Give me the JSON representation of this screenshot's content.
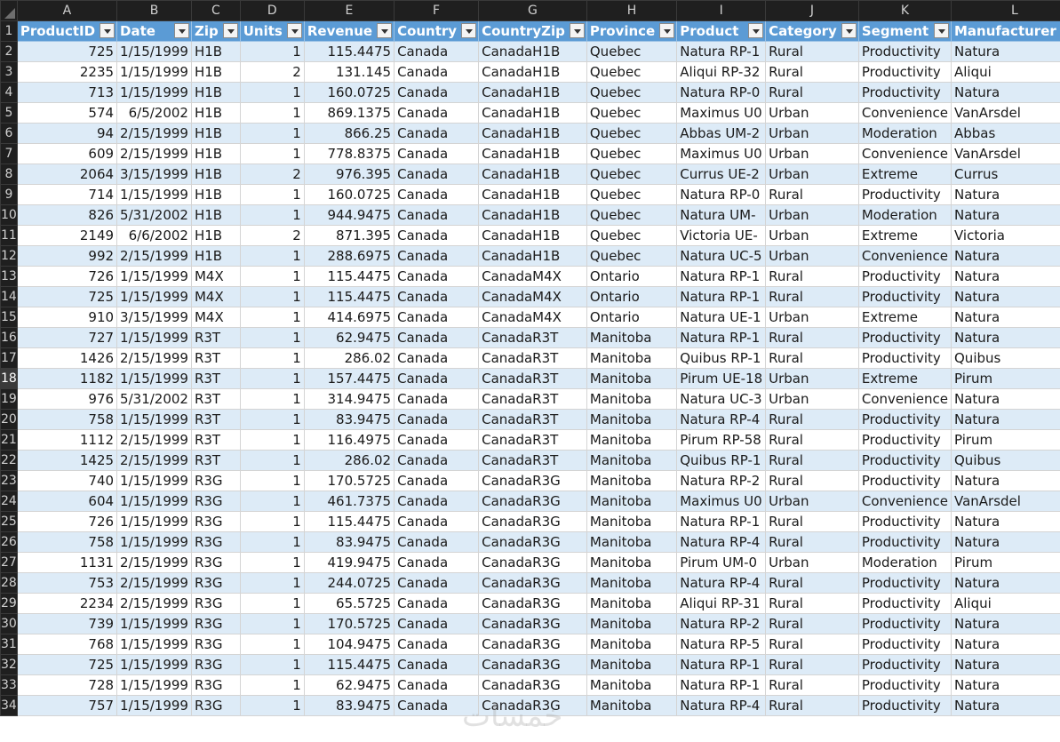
{
  "sheet": {
    "column_letters": [
      "A",
      "B",
      "C",
      "D",
      "E",
      "F",
      "G",
      "H",
      "I",
      "J",
      "K",
      "L"
    ],
    "headers": [
      "ProductID",
      "Date",
      "Zip",
      "Units",
      "Revenue",
      "Country",
      "CountryZip",
      "Province",
      "Product",
      "Category",
      "Segment",
      "Manufacturer"
    ],
    "selected_row": "18",
    "rows": [
      {
        "n": "2",
        "cells": [
          "725",
          "1/15/1999",
          "H1B",
          "1",
          "115.4475",
          "Canada",
          "CanadaH1B",
          "Quebec",
          "Natura RP-1",
          "Rural",
          "Productivity",
          "Natura"
        ]
      },
      {
        "n": "3",
        "cells": [
          "2235",
          "1/15/1999",
          "H1B",
          "2",
          "131.145",
          "Canada",
          "CanadaH1B",
          "Quebec",
          "Aliqui RP-32",
          "Rural",
          "Productivity",
          "Aliqui"
        ]
      },
      {
        "n": "4",
        "cells": [
          "713",
          "1/15/1999",
          "H1B",
          "1",
          "160.0725",
          "Canada",
          "CanadaH1B",
          "Quebec",
          "Natura RP-0",
          "Rural",
          "Productivity",
          "Natura"
        ]
      },
      {
        "n": "5",
        "cells": [
          "574",
          "6/5/2002",
          "H1B",
          "1",
          "869.1375",
          "Canada",
          "CanadaH1B",
          "Quebec",
          "Maximus U0",
          "Urban",
          "Convenience",
          "VanArsdel"
        ]
      },
      {
        "n": "6",
        "cells": [
          "94",
          "2/15/1999",
          "H1B",
          "1",
          "866.25",
          "Canada",
          "CanadaH1B",
          "Quebec",
          "Abbas UM-2",
          "Urban",
          "Moderation",
          "Abbas"
        ]
      },
      {
        "n": "7",
        "cells": [
          "609",
          "2/15/1999",
          "H1B",
          "1",
          "778.8375",
          "Canada",
          "CanadaH1B",
          "Quebec",
          "Maximus U0",
          "Urban",
          "Convenience",
          "VanArsdel"
        ]
      },
      {
        "n": "8",
        "cells": [
          "2064",
          "3/15/1999",
          "H1B",
          "2",
          "976.395",
          "Canada",
          "CanadaH1B",
          "Quebec",
          "Currus UE-2",
          "Urban",
          "Extreme",
          "Currus"
        ]
      },
      {
        "n": "9",
        "cells": [
          "714",
          "1/15/1999",
          "H1B",
          "1",
          "160.0725",
          "Canada",
          "CanadaH1B",
          "Quebec",
          "Natura RP-0",
          "Rural",
          "Productivity",
          "Natura"
        ]
      },
      {
        "n": "10",
        "cells": [
          "826",
          "5/31/2002",
          "H1B",
          "1",
          "944.9475",
          "Canada",
          "CanadaH1B",
          "Quebec",
          "Natura UM-",
          "Urban",
          "Moderation",
          "Natura"
        ]
      },
      {
        "n": "11",
        "cells": [
          "2149",
          "6/6/2002",
          "H1B",
          "2",
          "871.395",
          "Canada",
          "CanadaH1B",
          "Quebec",
          "Victoria UE-",
          "Urban",
          "Extreme",
          "Victoria"
        ]
      },
      {
        "n": "12",
        "cells": [
          "992",
          "2/15/1999",
          "H1B",
          "1",
          "288.6975",
          "Canada",
          "CanadaH1B",
          "Quebec",
          "Natura UC-5",
          "Urban",
          "Convenience",
          "Natura"
        ]
      },
      {
        "n": "13",
        "cells": [
          "726",
          "1/15/1999",
          "M4X",
          "1",
          "115.4475",
          "Canada",
          "CanadaM4X",
          "Ontario",
          "Natura RP-1",
          "Rural",
          "Productivity",
          "Natura"
        ]
      },
      {
        "n": "14",
        "cells": [
          "725",
          "1/15/1999",
          "M4X",
          "1",
          "115.4475",
          "Canada",
          "CanadaM4X",
          "Ontario",
          "Natura RP-1",
          "Rural",
          "Productivity",
          "Natura"
        ]
      },
      {
        "n": "15",
        "cells": [
          "910",
          "3/15/1999",
          "M4X",
          "1",
          "414.6975",
          "Canada",
          "CanadaM4X",
          "Ontario",
          "Natura UE-1",
          "Urban",
          "Extreme",
          "Natura"
        ]
      },
      {
        "n": "16",
        "cells": [
          "727",
          "1/15/1999",
          "R3T",
          "1",
          "62.9475",
          "Canada",
          "CanadaR3T",
          "Manitoba",
          "Natura RP-1",
          "Rural",
          "Productivity",
          "Natura"
        ]
      },
      {
        "n": "17",
        "cells": [
          "1426",
          "2/15/1999",
          "R3T",
          "1",
          "286.02",
          "Canada",
          "CanadaR3T",
          "Manitoba",
          "Quibus RP-1",
          "Rural",
          "Productivity",
          "Quibus"
        ]
      },
      {
        "n": "18",
        "cells": [
          "1182",
          "1/15/1999",
          "R3T",
          "1",
          "157.4475",
          "Canada",
          "CanadaR3T",
          "Manitoba",
          "Pirum UE-18",
          "Urban",
          "Extreme",
          "Pirum"
        ]
      },
      {
        "n": "19",
        "cells": [
          "976",
          "5/31/2002",
          "R3T",
          "1",
          "314.9475",
          "Canada",
          "CanadaR3T",
          "Manitoba",
          "Natura UC-3",
          "Urban",
          "Convenience",
          "Natura"
        ]
      },
      {
        "n": "20",
        "cells": [
          "758",
          "1/15/1999",
          "R3T",
          "1",
          "83.9475",
          "Canada",
          "CanadaR3T",
          "Manitoba",
          "Natura RP-4",
          "Rural",
          "Productivity",
          "Natura"
        ]
      },
      {
        "n": "21",
        "cells": [
          "1112",
          "2/15/1999",
          "R3T",
          "1",
          "116.4975",
          "Canada",
          "CanadaR3T",
          "Manitoba",
          "Pirum RP-58",
          "Rural",
          "Productivity",
          "Pirum"
        ]
      },
      {
        "n": "22",
        "cells": [
          "1425",
          "2/15/1999",
          "R3T",
          "1",
          "286.02",
          "Canada",
          "CanadaR3T",
          "Manitoba",
          "Quibus RP-1",
          "Rural",
          "Productivity",
          "Quibus"
        ]
      },
      {
        "n": "23",
        "cells": [
          "740",
          "1/15/1999",
          "R3G",
          "1",
          "170.5725",
          "Canada",
          "CanadaR3G",
          "Manitoba",
          "Natura RP-2",
          "Rural",
          "Productivity",
          "Natura"
        ]
      },
      {
        "n": "24",
        "cells": [
          "604",
          "1/15/1999",
          "R3G",
          "1",
          "461.7375",
          "Canada",
          "CanadaR3G",
          "Manitoba",
          "Maximus U0",
          "Urban",
          "Convenience",
          "VanArsdel"
        ]
      },
      {
        "n": "25",
        "cells": [
          "726",
          "1/15/1999",
          "R3G",
          "1",
          "115.4475",
          "Canada",
          "CanadaR3G",
          "Manitoba",
          "Natura RP-1",
          "Rural",
          "Productivity",
          "Natura"
        ]
      },
      {
        "n": "26",
        "cells": [
          "758",
          "1/15/1999",
          "R3G",
          "1",
          "83.9475",
          "Canada",
          "CanadaR3G",
          "Manitoba",
          "Natura RP-4",
          "Rural",
          "Productivity",
          "Natura"
        ]
      },
      {
        "n": "27",
        "cells": [
          "1131",
          "2/15/1999",
          "R3G",
          "1",
          "419.9475",
          "Canada",
          "CanadaR3G",
          "Manitoba",
          "Pirum UM-0",
          "Urban",
          "Moderation",
          "Pirum"
        ]
      },
      {
        "n": "28",
        "cells": [
          "753",
          "2/15/1999",
          "R3G",
          "1",
          "244.0725",
          "Canada",
          "CanadaR3G",
          "Manitoba",
          "Natura RP-4",
          "Rural",
          "Productivity",
          "Natura"
        ]
      },
      {
        "n": "29",
        "cells": [
          "2234",
          "2/15/1999",
          "R3G",
          "1",
          "65.5725",
          "Canada",
          "CanadaR3G",
          "Manitoba",
          "Aliqui RP-31",
          "Rural",
          "Productivity",
          "Aliqui"
        ]
      },
      {
        "n": "30",
        "cells": [
          "739",
          "1/15/1999",
          "R3G",
          "1",
          "170.5725",
          "Canada",
          "CanadaR3G",
          "Manitoba",
          "Natura RP-2",
          "Rural",
          "Productivity",
          "Natura"
        ]
      },
      {
        "n": "31",
        "cells": [
          "768",
          "1/15/1999",
          "R3G",
          "1",
          "104.9475",
          "Canada",
          "CanadaR3G",
          "Manitoba",
          "Natura RP-5",
          "Rural",
          "Productivity",
          "Natura"
        ]
      },
      {
        "n": "32",
        "cells": [
          "725",
          "1/15/1999",
          "R3G",
          "1",
          "115.4475",
          "Canada",
          "CanadaR3G",
          "Manitoba",
          "Natura RP-1",
          "Rural",
          "Productivity",
          "Natura"
        ]
      },
      {
        "n": "33",
        "cells": [
          "728",
          "1/15/1999",
          "R3G",
          "1",
          "62.9475",
          "Canada",
          "CanadaR3G",
          "Manitoba",
          "Natura RP-1",
          "Rural",
          "Productivity",
          "Natura"
        ]
      },
      {
        "n": "34",
        "cells": [
          "757",
          "1/15/1999",
          "R3G",
          "1",
          "83.9475",
          "Canada",
          "CanadaR3G",
          "Manitoba",
          "Natura RP-4",
          "Rural",
          "Productivity",
          "Natura"
        ]
      }
    ]
  },
  "watermark": "خمسات",
  "colors": {
    "header_fill": "#5b9bd5",
    "band_fill": "#ddebf7",
    "grid_header_bg": "#1f1f1f"
  }
}
